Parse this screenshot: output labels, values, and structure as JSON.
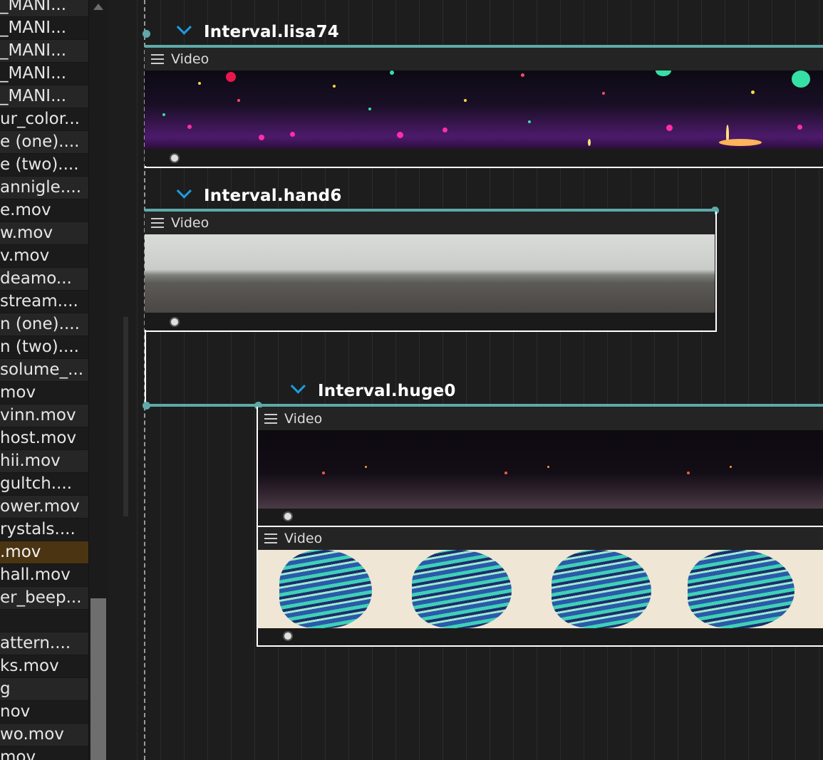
{
  "file_list": {
    "items": [
      {
        "label": "_MANI..."
      },
      {
        "label": "_MANI..."
      },
      {
        "label": "_MANI..."
      },
      {
        "label": "_MANI..."
      },
      {
        "label": "_MANI..."
      },
      {
        "label": "ur_color..."
      },
      {
        "label": "e (one)...."
      },
      {
        "label": "e (two)...."
      },
      {
        "label": "annigle...."
      },
      {
        "label": "e.mov"
      },
      {
        "label": "w.mov"
      },
      {
        "label": "v.mov"
      },
      {
        "label": "deamo..."
      },
      {
        "label": "stream...."
      },
      {
        "label": "n (one)...."
      },
      {
        "label": "n (two)...."
      },
      {
        "label": "solume_..."
      },
      {
        "label": "mov"
      },
      {
        "label": "vinn.mov"
      },
      {
        "label": "host.mov"
      },
      {
        "label": "hii.mov"
      },
      {
        "label": "gultch...."
      },
      {
        "label": "ower.mov"
      },
      {
        "label": "rystals...."
      },
      {
        "label": ".mov",
        "selected": true
      },
      {
        "label": " hall.mov"
      },
      {
        "label": "er_beep..."
      },
      {
        "label": ""
      },
      {
        "label": "attern...."
      },
      {
        "label": "ks.mov"
      },
      {
        "label": "g"
      },
      {
        "label": "nov"
      },
      {
        "label": "wo.mov"
      },
      {
        "label": "mov"
      }
    ]
  },
  "colors": {
    "accent_teal": "#5fa9aa",
    "chevron_blue": "#1e9be0",
    "selected_row": "#4a3412"
  },
  "intervals": [
    {
      "name": "Interval.lisa74",
      "processes": [
        {
          "label": "Video",
          "thumbnail": "space-particles"
        }
      ]
    },
    {
      "name": "Interval.hand6",
      "processes": [
        {
          "label": "Video",
          "thumbnail": "road-sky"
        }
      ]
    },
    {
      "name": "Interval.huge0",
      "processes": [
        {
          "label": "Video",
          "thumbnail": "night-road"
        },
        {
          "label": "Video",
          "thumbnail": "glitch-head"
        }
      ]
    }
  ]
}
